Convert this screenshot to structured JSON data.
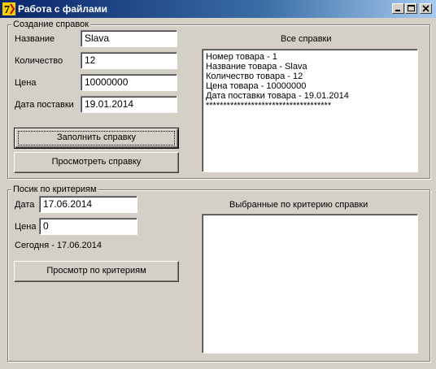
{
  "window": {
    "title": "Работа с файлами"
  },
  "create_group": {
    "title": "Создание справок",
    "fields": [
      {
        "label": "Название",
        "value": "Slava"
      },
      {
        "label": "Количество",
        "value": "12"
      },
      {
        "label": "Цена",
        "value": "10000000"
      },
      {
        "label": "Дата поставки",
        "value": "19.01.2014"
      }
    ],
    "fill_button": "Заполнить справку",
    "view_button": "Просмотреть справку",
    "all_title": "Все справки",
    "all_lines": [
      "Номер товара - 1",
      "Название товара - Slava",
      "Количество товара - 12",
      "Цена товара - 10000000",
      "Дата поставки товара - 19.01.2014",
      "************************************"
    ]
  },
  "search_group": {
    "title": "Посик по критериям",
    "date_label": "Дата",
    "date_value": "17.06.2014",
    "price_label": "Цена",
    "price_value": "0",
    "today_text": "Сегодня - 17.06.2014",
    "search_button": "Просмотр по критериям",
    "result_title": "Выбранные по критерию справки"
  }
}
